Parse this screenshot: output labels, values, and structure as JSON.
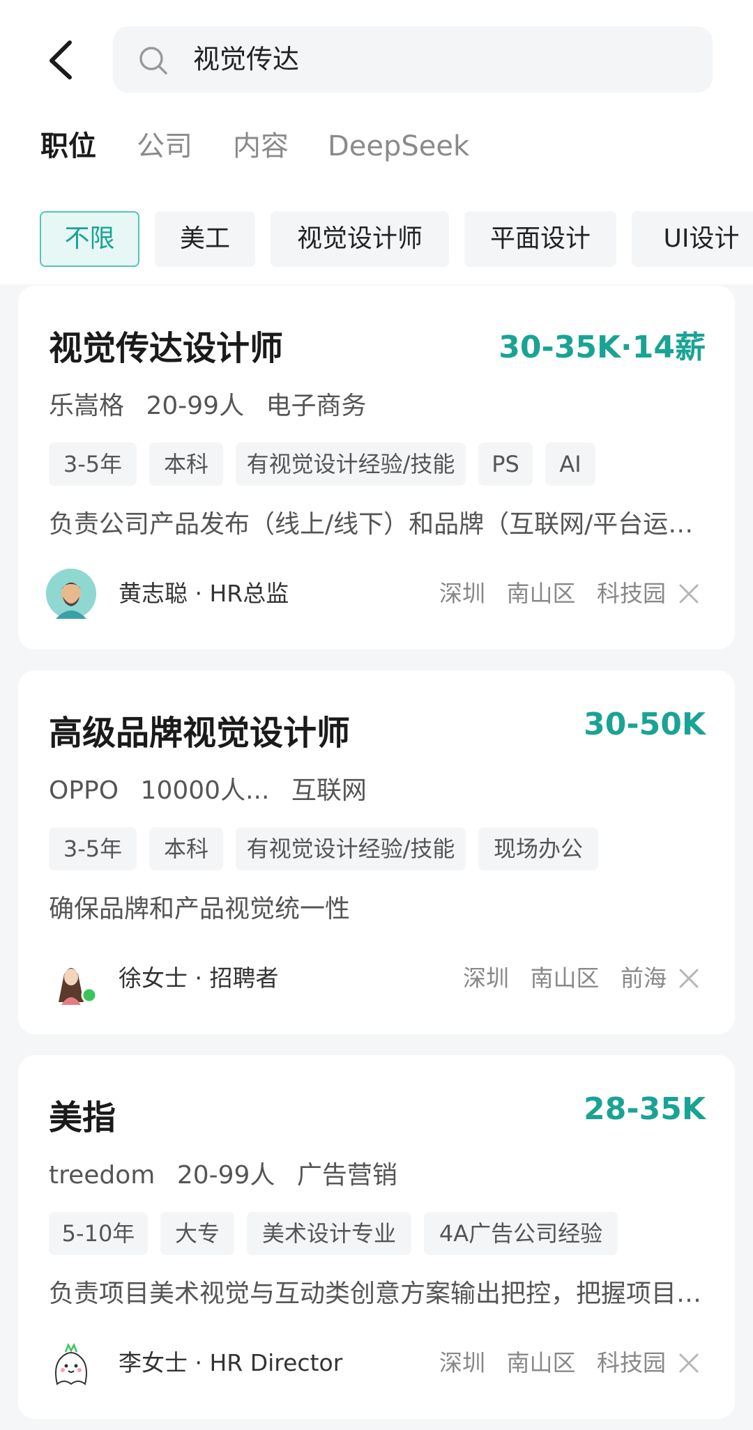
{
  "search": {
    "query": "视觉传达"
  },
  "tabs": [
    {
      "label": "职位"
    },
    {
      "label": "公司"
    },
    {
      "label": "内容"
    },
    {
      "label": "DeepSeek"
    }
  ],
  "filters": [
    {
      "label": "不限"
    },
    {
      "label": "美工"
    },
    {
      "label": "视觉设计师"
    },
    {
      "label": "平面设计"
    },
    {
      "label": "UI设计"
    }
  ],
  "jobs": [
    {
      "title": "视觉传达设计师",
      "salary": "30-35K·14薪",
      "company": "乐嵩格",
      "size": "20-99人",
      "industry": "电子商务",
      "tags": [
        "3-5年",
        "本科",
        "有视觉设计经验/技能",
        "PS",
        "AI"
      ],
      "description": "负责公司产品发布（线上/线下）和品牌（互联网/平台运营）",
      "recruiter": "黄志聪 · HR总监",
      "city": "深圳",
      "district": "南山区",
      "area": "科技园"
    },
    {
      "title": "高级品牌视觉设计师",
      "salary": "30-50K",
      "company": "OPPO",
      "size": "10000人...",
      "industry": "互联网",
      "tags": [
        "3-5年",
        "本科",
        "有视觉设计经验/技能",
        "现场办公"
      ],
      "description": "确保品牌和产品视觉统一性",
      "recruiter": "徐女士 · 招聘者",
      "city": "深圳",
      "district": "南山区",
      "area": "前海"
    },
    {
      "title": "美指",
      "salary": "28-35K",
      "company": "treedom",
      "size": "20-99人",
      "industry": "广告营销",
      "tags": [
        "5-10年",
        "大专",
        "美术设计专业",
        "4A广告公司经验"
      ],
      "description": "负责项目美术视觉与互动类创意方案输出把控，把握项目整体",
      "recruiter": "李女士 · HR Director",
      "city": "深圳",
      "district": "南山区",
      "area": "科技园"
    }
  ],
  "colors": {
    "accent": "#1aa395",
    "accent_bg": "#e6f7f5",
    "chip_bg": "#f4f5f7"
  }
}
